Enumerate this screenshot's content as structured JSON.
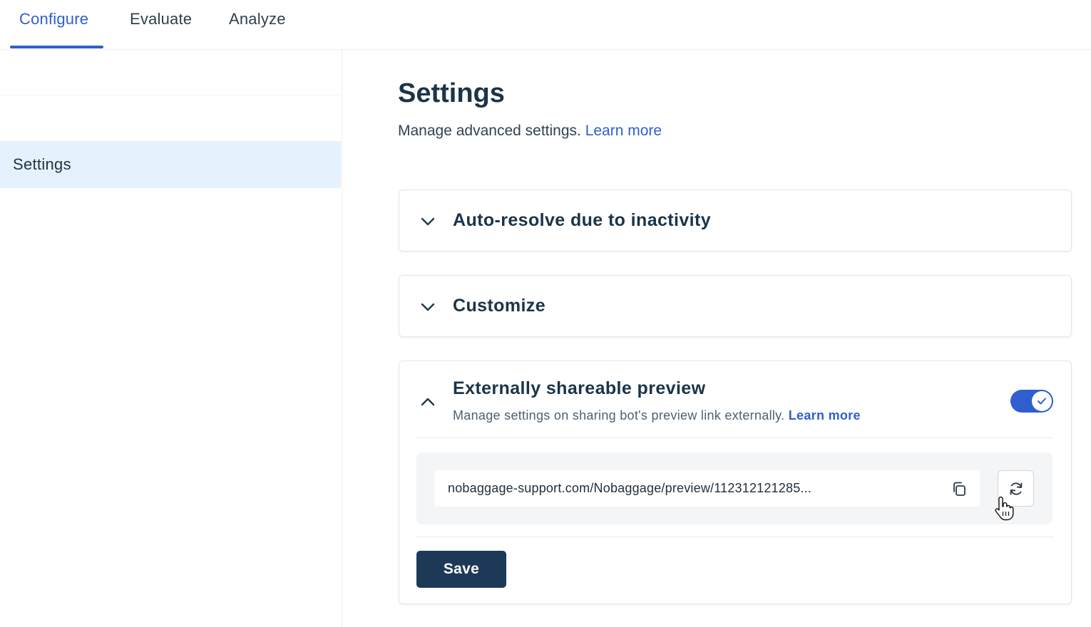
{
  "tabs": [
    {
      "label": "Configure",
      "active": true
    },
    {
      "label": "Evaluate",
      "active": false
    },
    {
      "label": "Analyze",
      "active": false
    }
  ],
  "sidebar": {
    "items": [
      {
        "label": "Settings",
        "selected": true
      }
    ]
  },
  "page": {
    "title": "Settings",
    "subtitle": "Manage advanced settings.",
    "learn_more": "Learn more"
  },
  "sections": [
    {
      "title": "Auto-resolve due to inactivity",
      "expanded": false,
      "chevron_icon": "chevron-down-icon"
    },
    {
      "title": "Customize",
      "expanded": false,
      "chevron_icon": "chevron-down-icon"
    },
    {
      "title": "Externally shareable preview",
      "expanded": true,
      "chevron_icon": "chevron-up-icon",
      "description": "Manage settings on sharing bot's preview link externally.",
      "learn_more": "Learn more",
      "toggle_on": true,
      "preview_url": "nobaggage-support.com/Nobaggage/preview/112312121285...",
      "copy_icon": "copy-icon",
      "refresh_icon": "refresh-icon",
      "save_label": "Save"
    }
  ],
  "colors": {
    "accent": "#2f5fcf",
    "selected_bg": "#e5f1fc",
    "primary_button": "#1c3a58"
  }
}
